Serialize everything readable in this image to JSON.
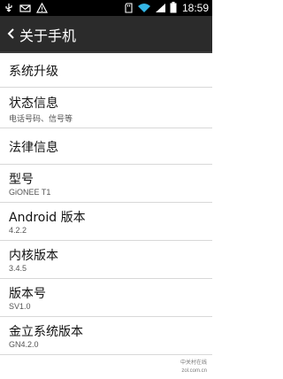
{
  "status_bar": {
    "time": "18:59",
    "left_icons": [
      "usb-icon",
      "mail-icon",
      "warning-icon"
    ],
    "right_icons": [
      "sd-card-icon",
      "wifi-icon",
      "signal-icon",
      "battery-icon"
    ]
  },
  "action_bar": {
    "title": "关于手机"
  },
  "settings": [
    {
      "title": "系统升级",
      "subtitle": ""
    },
    {
      "title": "状态信息",
      "subtitle": "电话号码、信号等"
    },
    {
      "title": "法律信息",
      "subtitle": ""
    },
    {
      "title": "型号",
      "subtitle": "GiONEE T1"
    },
    {
      "title": "Android 版本",
      "subtitle": "4.2.2"
    },
    {
      "title": "内核版本",
      "subtitle": "3.4.5"
    },
    {
      "title": "版本号",
      "subtitle": "SV1.0"
    },
    {
      "title": "金立系统版本",
      "subtitle": "GN4.2.0"
    }
  ],
  "watermark": {
    "line1": "中关村在线",
    "line2": "zol.com.cn"
  },
  "colors": {
    "status_bar_bg": "#000000",
    "action_bar_bg": "#2b2b2b",
    "list_bg": "#ffffff",
    "divider": "#d8d8d8",
    "wifi_accent": "#33b5e5"
  }
}
